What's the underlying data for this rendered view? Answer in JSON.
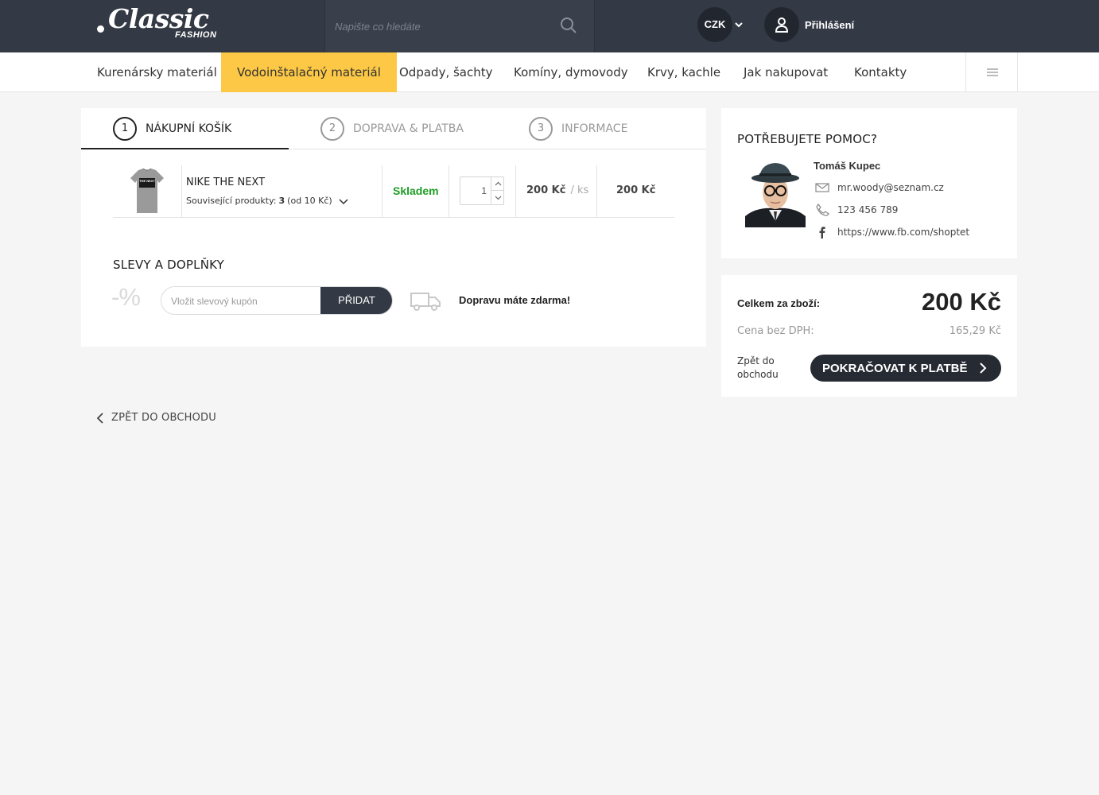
{
  "header": {
    "logo_word": "Classic",
    "logo_sub": "FASHION",
    "search_placeholder": "Napište co hledáte",
    "currency": "CZK",
    "login_label": "Přihlášení"
  },
  "nav": {
    "items": [
      {
        "label": "Kurenársky materiál",
        "active": false
      },
      {
        "label": "Vodoinštalačný materiál",
        "active": true
      },
      {
        "label": "Odpady, šachty",
        "active": false
      },
      {
        "label": "Komíny, dymovody",
        "active": false
      },
      {
        "label": "Krvy, kachle",
        "active": false
      },
      {
        "label": "Jak nakupovat",
        "active": false
      },
      {
        "label": "Kontakty",
        "active": false
      }
    ]
  },
  "steps": [
    {
      "num": "1",
      "label": "NÁKUPNÍ KOŠÍK",
      "active": true
    },
    {
      "num": "2",
      "label": "DOPRAVA & PLATBA",
      "active": false
    },
    {
      "num": "3",
      "label": "INFORMACE",
      "active": false
    }
  ],
  "cart_item": {
    "name": "NIKE THE NEXT",
    "related_label": "Související produkty:",
    "related_count": "3",
    "related_from": "(od 10 Kč)",
    "stock": "Skladem",
    "quantity": "1",
    "unit_price": "200 Kč",
    "unit": "/ ks",
    "total": "200 Kč",
    "image_text": "THE NEXT"
  },
  "discounts": {
    "title": "SLEVY A DOPLŇKY",
    "percent_symbol": "-%",
    "coupon_placeholder": "Vložit slevový kupón",
    "add_button": "PŘIDAT",
    "free_shipping": "Dopravu máte zdarma!"
  },
  "back_link": "ZPĚT DO OBCHODU",
  "help": {
    "title": "POTŘEBUJETE POMOC?",
    "name": "Tomáš Kupec",
    "email": "mr.woody@seznam.cz",
    "phone": "123 456 789",
    "facebook": "https://www.fb.com/shoptet"
  },
  "summary": {
    "total_label": "Celkem za zboží:",
    "total": "200 Kč",
    "net_label": "Cena bez DPH:",
    "net": "165,29 Kč",
    "back_label": "Zpět do obchodu",
    "checkout_label": "POKRAČOVAT K PLATBĚ"
  },
  "colors": {
    "header_bg": "#343a45",
    "nav_active": "#fcc845",
    "stock_green": "#1e9e24",
    "button_dark": "#262b33",
    "page_bg": "#f5f5f5"
  }
}
